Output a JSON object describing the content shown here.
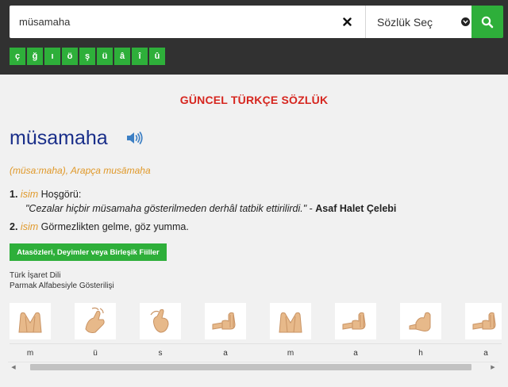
{
  "search": {
    "value": "müsamaha",
    "placeholder": ""
  },
  "dictionary_select": {
    "selected": "Sözlük Seç"
  },
  "special_chars": [
    "ç",
    "ğ",
    "ı",
    "ö",
    "ş",
    "ü",
    "â",
    "î",
    "û"
  ],
  "dictionary_title": "GÜNCEL TÜRKÇE SÖZLÜK",
  "entry": {
    "headword": "müsamaha",
    "etymology": "(müsa:maha), Arapça musāmaḥa",
    "meanings": [
      {
        "num": "1.",
        "type": "isim",
        "text": "Hoşgörü:",
        "example": {
          "quote": "\"Cezalar hiçbir müsamaha gösterilmeden derhâl tatbik ettirilirdi.\"",
          "separator": " - ",
          "author": "Asaf Halet Çelebi"
        }
      },
      {
        "num": "2.",
        "type": "isim",
        "text": "Görmezlikten gelme, göz yumma."
      }
    ]
  },
  "idioms_button": "Atasözleri, Deyimler veya Birleşik Fiiller",
  "sign_language": {
    "title": "Türk İşaret Dili",
    "subtitle": "Parmak Alfabesiyle Gösterilişi",
    "letters": [
      "m",
      "ü",
      "s",
      "a",
      "m",
      "a",
      "h",
      "a"
    ]
  },
  "colors": {
    "topbar": "#313131",
    "accent_green": "#2eaf3a",
    "title_red": "#d6261f",
    "headword_blue": "#1a2f8a",
    "etymology_orange": "#e0992a"
  }
}
